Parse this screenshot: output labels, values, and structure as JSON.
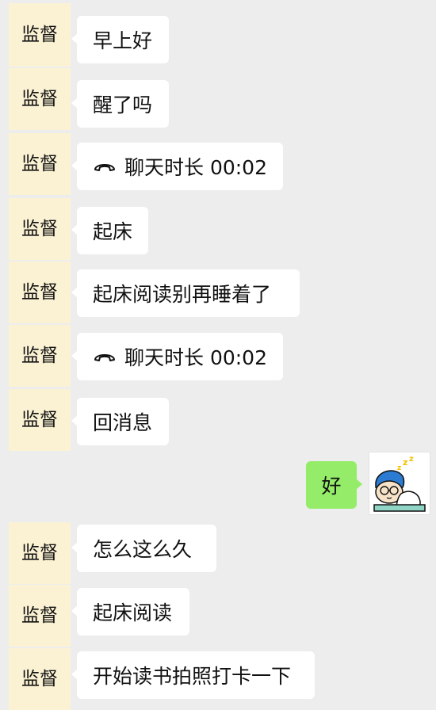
{
  "messages": [
    {
      "sender": "监督",
      "text": "早上好"
    },
    {
      "sender": "监督",
      "text": "醒了吗"
    },
    {
      "sender": "监督",
      "text": "聊天时长 00:02",
      "call": true
    },
    {
      "sender": "监督",
      "text": "起床"
    },
    {
      "sender": "监督",
      "text": "起床阅读别再睡着了"
    },
    {
      "sender": "监督",
      "text": "聊天时长 00:02",
      "call": true
    },
    {
      "sender": "监督",
      "text": "回消息"
    },
    {
      "sender": "self",
      "text": "好"
    },
    {
      "sender": "监督",
      "text": "怎么这么久"
    },
    {
      "sender": "监督",
      "text": "起床阅读"
    },
    {
      "sender": "监督",
      "text": "开始读书拍照打卡一下"
    }
  ],
  "colors": {
    "background": "#ededed",
    "contact_avatar": "#fbf2d4",
    "incoming_bubble": "#ffffff",
    "outgoing_bubble": "#95ec69"
  },
  "icons": {
    "call": "phone-hangup-icon",
    "self_avatar": "sleeping-cartoon-avatar"
  }
}
